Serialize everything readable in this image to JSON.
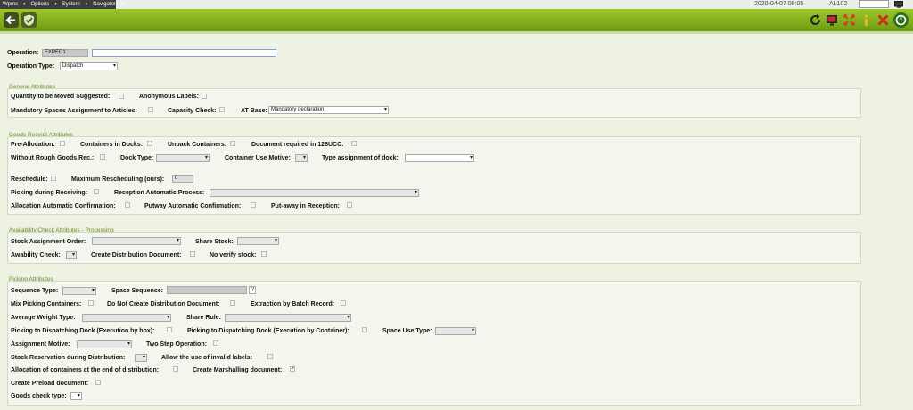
{
  "menubar": {
    "items": [
      "Wpms",
      "Options",
      "System",
      "Navigator"
    ],
    "datetime": "2020-04-07 09:05",
    "station": "AL102"
  },
  "icons": {
    "back": "back-arrow-icon",
    "shield": "shield-check-icon",
    "refresh": "refresh-icon",
    "screen": "screen-icon",
    "expand": "expand-icon",
    "info": "info-icon",
    "close": "close-x-icon",
    "exit": "exit-icon"
  },
  "header": {
    "operation_label": "Operation:",
    "operation_code": "EXPED1",
    "operation_desc": "",
    "operation_type_label": "Operation Type:",
    "operation_type_value": "Dispatch"
  },
  "general": {
    "title": "General Attributes",
    "qty_suggested": "Quantity to be Moved Suggested:",
    "anon_labels": "Anonymous Labels:",
    "mandatory_spaces": "Mandatory Spaces Assignment to Articles:",
    "capacity_check": "Capacity Check:",
    "at_base": "AT Base:",
    "at_base_value": "Mandatory declaration"
  },
  "receipt": {
    "title": "Goods Receipt Attributes",
    "pre_allocation": "Pre-Allocation:",
    "containers_docks": "Containers in Docks:",
    "unpack_containers": "Unpack Containers:",
    "doc_required": "Document required in 128UCC:",
    "without_rough": "Without Rough Goods Rec.:",
    "dock_type": "Dock Type:",
    "container_use_motive": "Container Use Motive:",
    "type_assignment_dock": "Type assignment of dock:",
    "reschedule": "Reschedule:",
    "max_rescheduling": "Maximum Rescheduling (ours):",
    "max_rescheduling_value": "0",
    "picking_receiving": "Picking during Receiving:",
    "reception_auto": "Reception Automatic Process:",
    "allocation_auto": "Allocation Automatic Confirmation:",
    "putway_auto": "Putway Automatic Confirmation:",
    "putaway_reception": "Put-away in Reception:"
  },
  "availability": {
    "title": "Availability Check Attributes - Processing",
    "stock_order": "Stock Assignment Order:",
    "share_stock": "Share Stock:",
    "avail_check": "Awability Check:",
    "create_dist_doc": "Create Distribution Document:",
    "no_verify": "No verify stock:"
  },
  "picking": {
    "title": "Picking Attributes",
    "sequence_type": "Sequence Type:",
    "space_sequence": "Space Sequence:",
    "space_sequence_btn": "?",
    "mix_containers": "Mix Picking Containers:",
    "no_dist_doc": "Do Not Create Distribution Document:",
    "extraction_batch": "Extraction by Batch Record:",
    "avg_weight": "Average Weight Type:",
    "share_rule": "Share Rule:",
    "pick_dock_box": "Picking to Dispatching Dock (Execution by box):",
    "pick_dock_container": "Picking to Dispatching Dock (Execution by Container):",
    "space_use_type": "Space Use Type:",
    "assignment_motive": "Assignment Motive:",
    "two_step": "Two Step Operation:",
    "stock_reservation": "Stock Reservation during Distribution:",
    "invalid_labels": "Allow the use of invalid labels:",
    "alloc_containers_end": "Allocation of containers at the end of distribution:",
    "create_marshalling": "Create Marshalling document:",
    "create_preload": "Create Preload document:",
    "goods_check_type": "Goods check type:"
  },
  "colors": {
    "toolbar": "#8cb82a",
    "section_title": "#6a8a22",
    "background": "#eef2e3"
  }
}
